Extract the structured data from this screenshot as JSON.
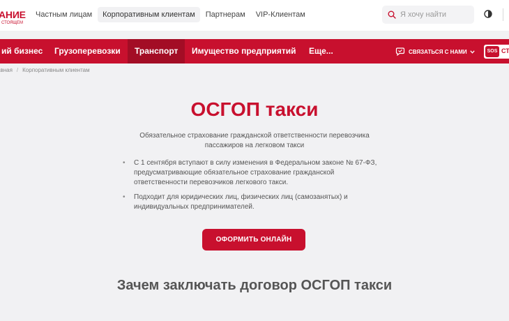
{
  "logo": {
    "main": "АНИЕ",
    "sub": "СТОЯЩЕМ"
  },
  "top_nav": [
    {
      "label": "Частным лицам"
    },
    {
      "label": "Корпоративным клиентам",
      "active": true
    },
    {
      "label": "Партнерам"
    },
    {
      "label": "VIP-Клиентам"
    }
  ],
  "search": {
    "placeholder": "Я хочу найти"
  },
  "main_nav": [
    {
      "label": "ий бизнес"
    },
    {
      "label": "Грузоперевозки"
    },
    {
      "label": "Транспорт",
      "active": true
    },
    {
      "label": "Имущество предприятий"
    },
    {
      "label": "Еще..."
    }
  ],
  "contact": {
    "label": "СВЯЗАТЬСЯ С НАМИ"
  },
  "sos": {
    "badge": "SOS",
    "label": "СТ"
  },
  "breadcrumb": {
    "home": "авная",
    "current": "Корпоративным клиентам",
    "separator": "/"
  },
  "hero": {
    "title": "ОСГОП такси",
    "subtitle": "Обязательное страхование гражданской ответственности перевозчика пассажиров на легковом такси",
    "bullets": [
      "С 1 сентября вступают в силу изменения в Федеральном законе № 67-ФЗ, предусматривающие обязательное страхование гражданской ответственности перевозчиков легкового такси.",
      "Подходит для юридических лиц, физических лиц (самозанятых) и индивидуальных предпринимателей."
    ],
    "cta": "ОФОРМИТЬ ОНЛАЙН"
  },
  "section_title": "Зачем заключать договор ОСГОП такси",
  "colors": {
    "brand": "#c8102e",
    "brand_dark": "#a30d25",
    "background": "#f1f1f3"
  }
}
